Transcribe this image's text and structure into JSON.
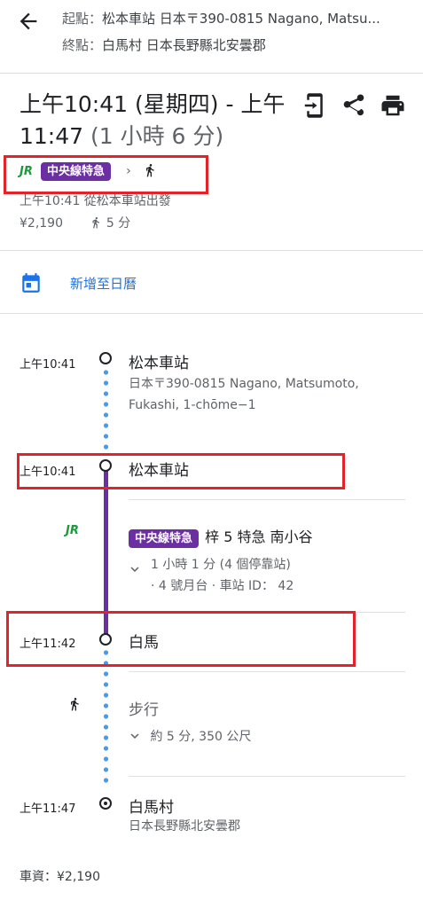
{
  "header": {
    "origin_key": "起點：",
    "origin_value": "松本車站 日本〒390-0815 Nagano, Matsu...",
    "dest_key": "終點：",
    "dest_value": "白馬村 日本長野縣北安曇郡"
  },
  "summary": {
    "time_range": "上午10:41 (星期四) - 上午 11:47",
    "duration": "(1 小時 6 分)",
    "line_badge": "中央線特急",
    "jr_label": "JR",
    "depart_text": "上午10:41 從松本車站出發",
    "fare": "¥2,190",
    "walk_time": "5 分"
  },
  "calendar": {
    "label": "新增至日曆"
  },
  "timeline": {
    "stop1_time": "上午10:41",
    "stop1_name": "松本車站",
    "stop1_addr": "日本〒390-0815 Nagano, Matsumoto, Fukashi, 1-chōme−1",
    "stop2_time": "上午10:41",
    "stop2_name": "松本車站",
    "train_jr": "JR",
    "train_badge": "中央線特急",
    "train_desc": "梓 5 特急 南小谷",
    "train_detail1": "1 小時 1 分 (4 個停靠站)",
    "train_detail2": "· 4 號月台 · 車站 ID： 42",
    "stop3_time": "上午11:42",
    "stop3_name": "白馬",
    "walk_label": "步行",
    "walk_detail": "約 5 分, 350 公尺",
    "stop4_time": "上午11:47",
    "stop4_name": "白馬村",
    "stop4_addr": "日本長野縣北安曇郡"
  },
  "footer": {
    "fare_total": "車資：¥2,190"
  },
  "colors": {
    "line_purple": "#6c2ea3",
    "walk_blue": "#4a9ae8",
    "link_blue": "#1a73e8",
    "highlight_red": "#e32329",
    "jr_green": "#1a9a3a"
  }
}
